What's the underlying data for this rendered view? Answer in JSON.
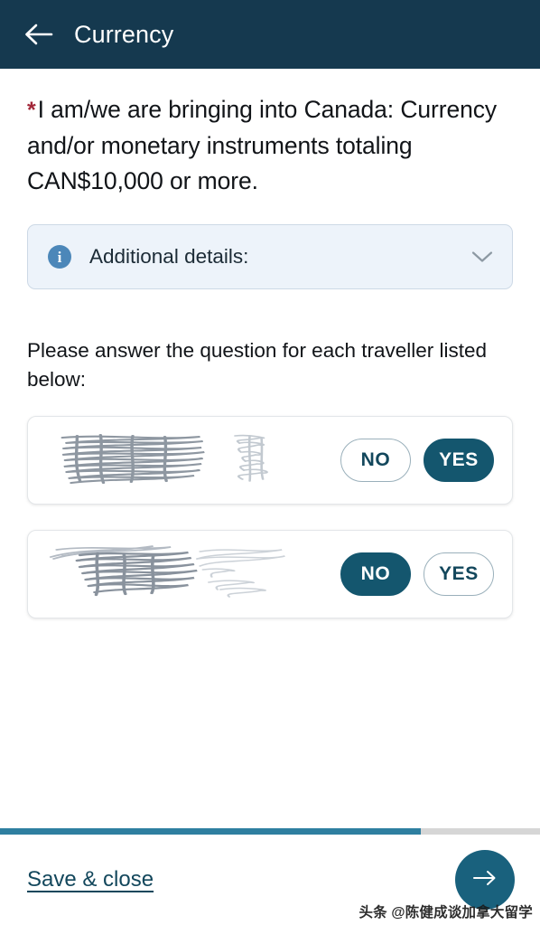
{
  "header": {
    "title": "Currency",
    "back_icon": "arrow-left-icon",
    "background_color": "#15394f"
  },
  "question": {
    "required_marker": "*",
    "required_marker_color": "#a22638",
    "text": "I am/we are bringing into Canada: Currency and/or monetary instruments totaling CAN$10,000 or more."
  },
  "additional_details": {
    "icon": "info-circle-icon",
    "label": "Additional details:",
    "expand_icon": "chevron-down-icon",
    "expanded": "false",
    "background_color": "#edf3fa"
  },
  "instruction": "Please answer the question for each traveller listed below:",
  "travellers": [
    {
      "name": "",
      "name_redacted": "true",
      "options": [
        {
          "label": "NO",
          "selected": "false"
        },
        {
          "label": "YES",
          "selected": "true"
        }
      ]
    },
    {
      "name": "",
      "name_redacted": "true",
      "options": [
        {
          "label": "NO",
          "selected": "true"
        },
        {
          "label": "YES",
          "selected": "false"
        }
      ]
    }
  ],
  "footer": {
    "progress_percent": 78,
    "progress_color": "#2e7fa0",
    "save_label": "Save & close",
    "next_icon": "arrow-right-icon",
    "next_color": "#19617d"
  },
  "watermark": "头条 @陈健成谈加拿大留学"
}
